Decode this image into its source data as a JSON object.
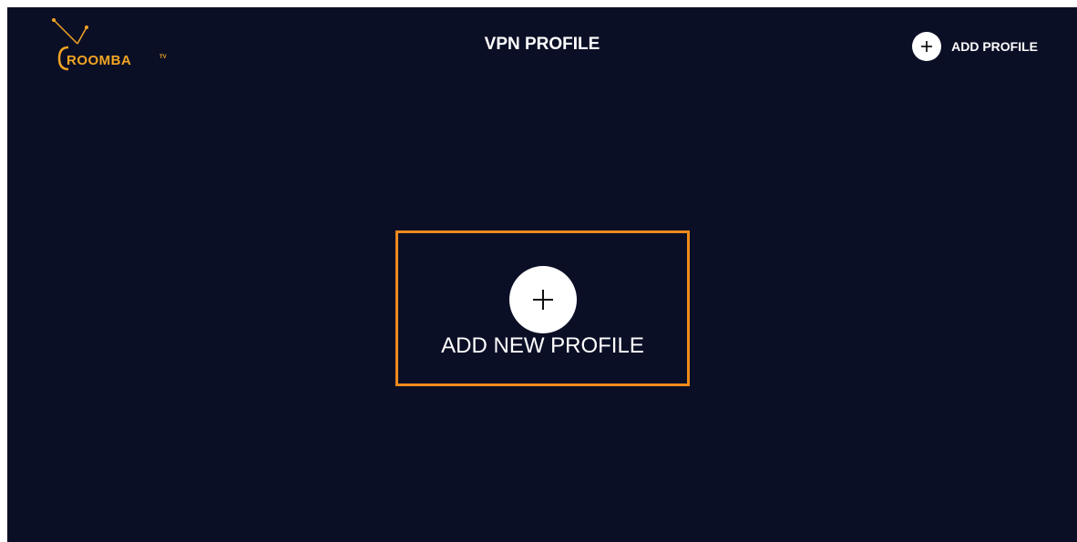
{
  "logo": {
    "text": "ROOMBA",
    "superscript": "TV",
    "color": "#f2a523"
  },
  "header": {
    "title": "VPN PROFILE",
    "add_button_label": "ADD PROFILE",
    "add_icon": "plus-icon"
  },
  "main": {
    "add_card_label": "ADD NEW PROFILE",
    "add_card_icon": "plus-icon",
    "focus_border_color": "#f08a1c"
  },
  "colors": {
    "background": "#0b0f26",
    "text": "#ffffff"
  }
}
